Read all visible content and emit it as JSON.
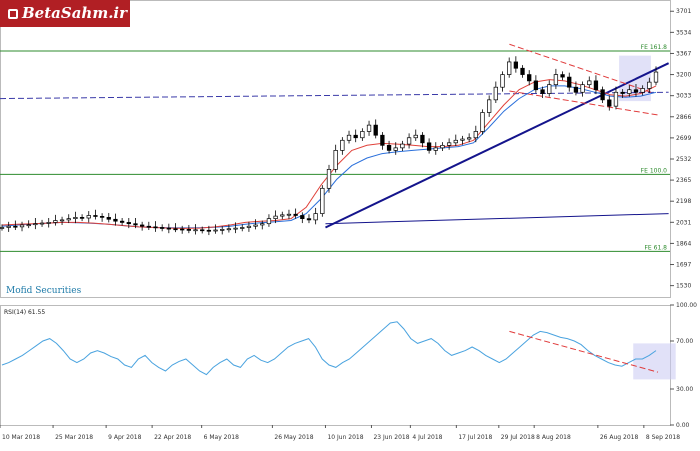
{
  "branding": {
    "logo_text": "BetaSahm.ir",
    "watermark": "Mofid Securities"
  },
  "colors": {
    "candle_up": "#ffffff",
    "candle_down": "#000000",
    "ma_fast": "#e0413a",
    "ma_slow": "#2a6fdb",
    "fib": "#2e8b2e",
    "trend": "#14148c",
    "channel": "#e03b3b",
    "dashed_h": "#3a3aa8",
    "rsi": "#4aa3df",
    "highlight": "#c9c9f2"
  },
  "chart_data": [
    {
      "type": "candlestick",
      "title": "",
      "y_ticks": [
        "3701",
        "3534",
        "3367",
        "3200",
        "3033",
        "2866",
        "2699",
        "2532",
        "2365",
        "2198",
        "2031",
        "1864",
        "1697",
        "1530"
      ],
      "ylim": [
        1440,
        3790
      ],
      "x_ticks": [
        "10 Mar 2018",
        "25 Mar 2018",
        "9 Apr 2018",
        "22 Apr 2018",
        "6 May 2018",
        "26 May 2018",
        "10 Jun 2018",
        "23 Jun 2018",
        "4 Jul 2018",
        "17 Jul 2018",
        "29 Jul 2018",
        "8 Aug 2018",
        "26 Aug 2018",
        "8 Sep 2018"
      ],
      "levels": [
        {
          "label": "FE 161.8",
          "value": 3386
        },
        {
          "label": "FE 100.0",
          "value": 2410
        },
        {
          "label": "FE 61.8",
          "value": 1801
        }
      ],
      "candle_closes": [
        1990,
        2000,
        1995,
        2010,
        2012,
        2020,
        2025,
        2030,
        2045,
        2050,
        2060,
        2070,
        2065,
        2085,
        2078,
        2070,
        2055,
        2040,
        2030,
        2020,
        2010,
        2000,
        1995,
        1990,
        1985,
        1980,
        1978,
        1975,
        1970,
        1972,
        1968,
        1965,
        1970,
        1975,
        1980,
        1985,
        1990,
        2000,
        2010,
        2020,
        2060,
        2080,
        2090,
        2095,
        2085,
        2060,
        2050,
        2100,
        2300,
        2450,
        2600,
        2680,
        2720,
        2700,
        2750,
        2800,
        2720,
        2640,
        2600,
        2620,
        2650,
        2700,
        2720,
        2660,
        2600,
        2620,
        2640,
        2660,
        2680,
        2690,
        2700,
        2750,
        2900,
        3000,
        3100,
        3200,
        3300,
        3250,
        3200,
        3150,
        3080,
        3050,
        3120,
        3200,
        3180,
        3100,
        3060,
        3120,
        3150,
        3080,
        3000,
        2950,
        3060,
        3050,
        3080,
        3060,
        3090,
        3140,
        3220
      ],
      "x_start": "10 Mar 2018",
      "x_end": "12 Sep 2018",
      "ma_fast": [
        2010,
        2015,
        2020,
        2025,
        2030,
        2030,
        2025,
        2015,
        2005,
        1995,
        1990,
        1985,
        1983,
        1985,
        1995,
        2010,
        2030,
        2040,
        2045,
        2060,
        2150,
        2330,
        2480,
        2600,
        2640,
        2655,
        2650,
        2640,
        2630,
        2630,
        2640,
        2680,
        2820,
        2960,
        3080,
        3140,
        3160,
        3150,
        3120,
        3080,
        3040,
        3030,
        3050,
        3110
      ],
      "ma_slow": [
        2000,
        2010,
        2018,
        2025,
        2030,
        2028,
        2022,
        2015,
        2005,
        1995,
        1990,
        1988,
        1987,
        1988,
        1992,
        2000,
        2015,
        2028,
        2035,
        2045,
        2100,
        2220,
        2370,
        2480,
        2540,
        2575,
        2590,
        2600,
        2610,
        2620,
        2630,
        2660,
        2780,
        2910,
        3010,
        3080,
        3110,
        3110,
        3090,
        3060,
        3030,
        3020,
        3030,
        3060
      ],
      "trendlines": [
        {
          "name": "uptrend",
          "from": [
            "10 Jun 2018",
            1990
          ],
          "to": [
            "15 Sep 2018",
            3290
          ]
        },
        {
          "name": "horizontal-dashed",
          "from": [
            "10 Mar 2018",
            3010
          ],
          "to": [
            "15 Sep 2018",
            3060
          ]
        },
        {
          "name": "long-flat",
          "from": [
            "10 Jun 2018",
            2020
          ],
          "to": [
            "15 Sep 2018",
            2100
          ]
        },
        {
          "name": "channel-top",
          "from": [
            "1 Aug 2018",
            3440
          ],
          "to": [
            "10 Sep 2018",
            3060
          ]
        },
        {
          "name": "channel-bottom",
          "from": [
            "1 Aug 2018",
            3070
          ],
          "to": [
            "12 Sep 2018",
            2880
          ]
        }
      ]
    },
    {
      "type": "line",
      "title": "RSI(14) 61.55",
      "ylim": [
        0,
        100
      ],
      "y_ticks": [
        "100.00",
        "70.00",
        "30.00",
        "0.00"
      ],
      "series": [
        {
          "values": [
            50,
            52,
            55,
            58,
            62,
            66,
            70,
            72,
            68,
            62,
            55,
            52,
            55,
            60,
            62,
            60,
            57,
            55,
            50,
            48,
            55,
            58,
            52,
            48,
            45,
            50,
            53,
            55,
            50,
            45,
            42,
            48,
            52,
            55,
            50,
            48,
            55,
            58,
            54,
            52,
            55,
            60,
            65,
            68,
            70,
            72,
            65,
            55,
            50,
            48,
            52,
            55,
            60,
            65,
            70,
            75,
            80,
            85,
            86,
            80,
            72,
            68,
            70,
            72,
            68,
            62,
            58,
            60,
            62,
            65,
            62,
            58,
            55,
            52,
            55,
            60,
            65,
            70,
            75,
            78,
            77,
            75,
            73,
            72,
            70,
            67,
            62,
            58,
            55,
            52,
            50,
            49,
            52,
            55,
            55,
            58,
            62
          ]
        }
      ],
      "trendline": {
        "from": [
          "1 Aug 2018",
          78
        ],
        "to": [
          "12 Sep 2018",
          44
        ]
      }
    }
  ]
}
